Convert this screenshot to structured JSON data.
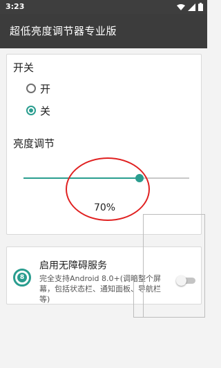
{
  "status_bar": {
    "time": "3:23"
  },
  "app_bar": {
    "title": "超低亮度调节器专业版"
  },
  "power_section": {
    "title": "开关",
    "options": [
      {
        "label": "开",
        "checked": false
      },
      {
        "label": "关",
        "checked": true
      }
    ]
  },
  "brightness_section": {
    "title": "亮度调节",
    "level": 0.7,
    "percent_text": "70%"
  },
  "service": {
    "title": "启用无障碍服务",
    "description": "完全支持Android 8.0+(调暗整个屏幕，包括状态栏、通知面板、导航栏等)",
    "icon_text": "8",
    "enabled": false
  },
  "colors": {
    "accent": "#2a9d8f",
    "annotation": "#e02020",
    "app_bar": "#3c3c3c"
  }
}
